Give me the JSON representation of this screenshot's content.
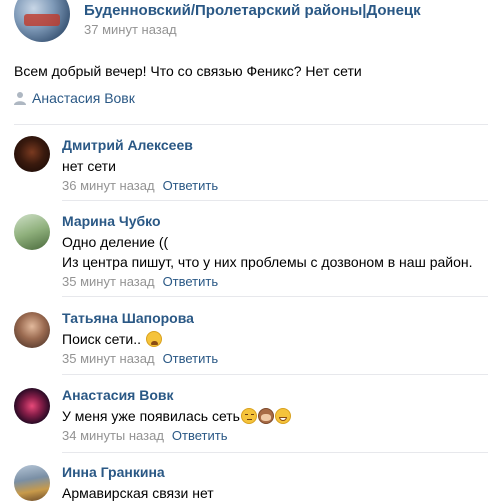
{
  "post": {
    "group_name": "Буденновский/Пролетарский районы|Донецк",
    "time": "37 минут назад",
    "text": "Всем добрый вечер! Что со связью Феникс? Нет сети",
    "signer": "Анастасия Вовк",
    "signer_icon": "person-icon"
  },
  "comments": [
    {
      "author": "Дмитрий Алексеев",
      "lines": [
        "нет сети"
      ],
      "time": "36 минут назад",
      "reply": "Ответить"
    },
    {
      "author": "Марина Чубко",
      "lines": [
        "Одно деление ((",
        "Из центра пишут, что у них проблемы с дозвоном в наш район."
      ],
      "time": "35 минут назад",
      "reply": "Ответить"
    },
    {
      "author": "Татьяна Шапорова",
      "lines": [
        "Поиск сети.."
      ],
      "emoji": [
        "weary-face-emoji"
      ],
      "time": "35 минут назад",
      "reply": "Ответить"
    },
    {
      "author": "Анастасия Вовк",
      "lines": [
        "У меня уже появилась сеть"
      ],
      "emoji": [
        "unamused-face-emoji",
        "see-no-evil-monkey-emoji",
        "grinning-face-emoji"
      ],
      "time": "34 минуты назад",
      "reply": "Ответить"
    },
    {
      "author": "Инна Гранкина",
      "lines": [
        "Армавирская связи нет"
      ]
    }
  ],
  "colors": {
    "link": "#2a5885",
    "meta": "#939393",
    "divider": "#e7e8ec"
  }
}
